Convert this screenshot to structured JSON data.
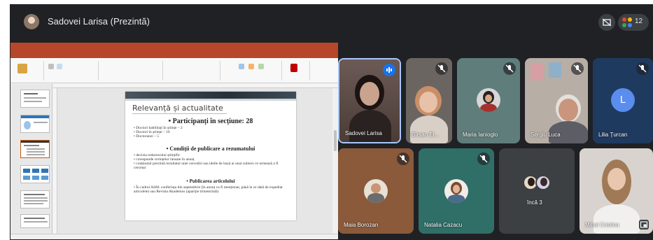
{
  "meeting": {
    "presenter_label": "Sadovei Larisa (Prezintă)",
    "participant_count": "12",
    "icons": {
      "presenter_avatar": "avatar-icon",
      "presentation_toggle": "present-screen-icon",
      "participants": "participants-icon"
    }
  },
  "slide": {
    "title": "Relevanță și actualitate",
    "sections": [
      {
        "heading": "Participanți în secțiune: 28",
        "bullets": [
          "Doctori habilitați în științe – 2",
          "Doctori în științe – 10",
          "Doctoranzi – 5"
        ]
      },
      {
        "heading": "Condiții de publicare a rezumatului",
        "bullets": [
          "decizia redactorului științific",
          "corespunde cerințelor lansate în anunț",
          "conținutul prezintă rezultatul unei cercetări sau ideile de bază ai unui subiect ce urmează a fi cercetat"
        ]
      },
      {
        "heading": "Publicarea articolului",
        "bullets": [
          "În cadrul ASM: conferința din septembrie (în anunț va fi menționat, până la ce dată de expediat articolele) sau Revista Akademos (apariție trimestrială)"
        ]
      }
    ]
  },
  "participants": [
    {
      "name": "Sadovei Larisa",
      "status": "speaking",
      "kind": "video"
    },
    {
      "name": "Bîrsan El...",
      "status": "muted",
      "kind": "video"
    },
    {
      "name": "Maria Ianioglo",
      "status": "muted",
      "kind": "avatar"
    },
    {
      "name": "Sergiu Luca",
      "status": "muted",
      "kind": "video"
    },
    {
      "name": "Lilia Țurcan",
      "status": "muted",
      "kind": "initial",
      "initial": "L"
    },
    {
      "name": "Maia Borozan",
      "status": "muted",
      "kind": "avatar"
    },
    {
      "name": "Natalia Cazacu",
      "status": "muted",
      "kind": "avatar"
    },
    {
      "name": "încă 3",
      "status": "none",
      "kind": "group"
    },
    {
      "name": "Mihai Cristina",
      "status": "self",
      "kind": "video"
    }
  ],
  "colors": {
    "meet_bg": "#202124",
    "tile_bg": "#3c4043",
    "speaking_blue": "#1a73e8",
    "muted_badge": "#5f6368",
    "powerpoint_red": "#b7472a",
    "initial_avatar": "#5b8def"
  }
}
